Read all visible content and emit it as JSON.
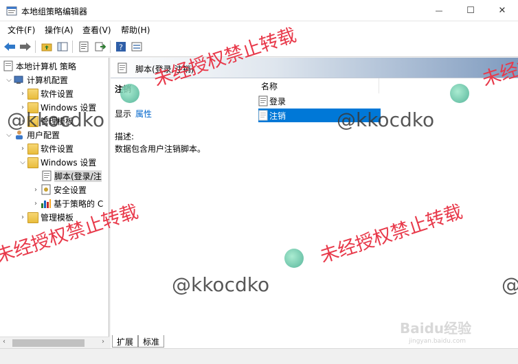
{
  "window": {
    "title": "本地组策略编辑器",
    "minimize_glyph": "—",
    "maximize_glyph": "☐",
    "close_glyph": "✕"
  },
  "menu": {
    "file": "文件(F)",
    "action": "操作(A)",
    "view": "查看(V)",
    "help": "帮助(H)"
  },
  "tree": {
    "root": "本地计算机 策略",
    "computer_config": "计算机配置",
    "cc_software": "软件设置",
    "cc_windows": "Windows 设置",
    "cc_admin": "管理模板",
    "user_config": "用户配置",
    "uc_software": "软件设置",
    "uc_windows": "Windows 设置",
    "uc_scripts": "脚本(登录/注",
    "uc_security": "安全设置",
    "uc_policy_qos": "基于策略的 C",
    "uc_admin": "管理模板"
  },
  "right": {
    "header": "脚本(登录/注销)",
    "ext_title": "注销",
    "show_label": "显示",
    "properties_link": "属性",
    "desc_label": "描述:",
    "desc_text": "数据包含用户注销脚本。",
    "column_name": "名称",
    "items": [
      "登录",
      "注销"
    ]
  },
  "tabs": {
    "extended": "扩展",
    "standard": "标准"
  },
  "watermarks": {
    "red_text": "未经授权禁止转载",
    "gray_text": "@kkocdko",
    "baidu": "Baidu经验",
    "baidu_url": "jingyan.baidu.com"
  }
}
